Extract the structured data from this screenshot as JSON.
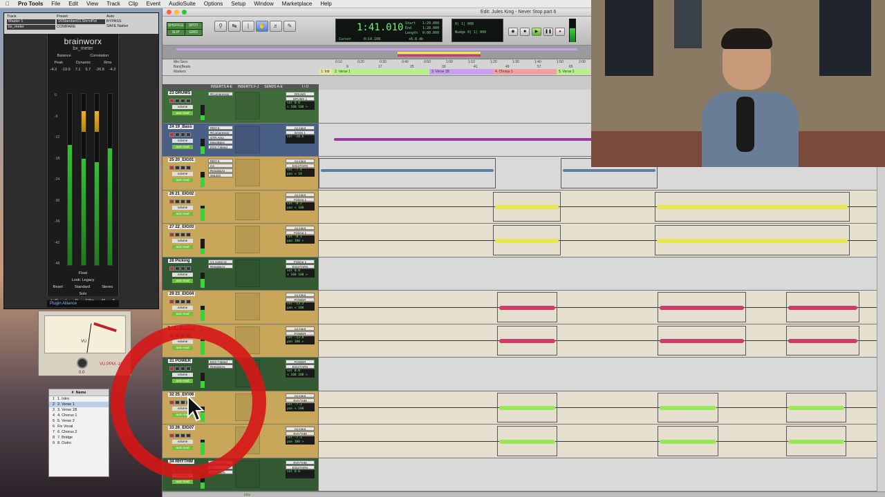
{
  "menubar": {
    "app": "Pro Tools",
    "items": [
      "File",
      "Edit",
      "View",
      "Track",
      "Clip",
      "Event",
      "AudioSuite",
      "Options",
      "Setup",
      "Window",
      "Marketplace",
      "Help"
    ]
  },
  "plugin": {
    "head": {
      "track_label": "Track",
      "track_value": "Master 1",
      "preset_label": "Preset",
      "preset_value": "16Standard1LShrmPot",
      "auto_label": "Auto",
      "bypass": "BYPASS",
      "compare": "COMPARE",
      "safe": "SAFE",
      "native": "Native",
      "insert": "bx_meter"
    },
    "brand": "brainworx",
    "subtitle": "bx_meter",
    "balance": "Balance",
    "correlation": "Correlation",
    "dynamic": "Dynamic",
    "peak": "Peak",
    "rms": "Rms",
    "values_row": [
      "-4.3",
      "-19.9",
      "7.1",
      "5.7",
      "-20.8",
      "-4.2"
    ],
    "scale": [
      "0",
      "-3",
      "-6",
      "-9",
      "-12",
      "-15",
      "-18",
      "-21",
      "-24",
      "-27",
      "-30",
      "-33",
      "-36",
      "-39",
      "-42",
      "-45",
      "-48"
    ],
    "float": "Float",
    "look": "Look: Legacy",
    "reset": "Reset",
    "standard": "Standard",
    "stereo": "Stereo",
    "solo": "Solo",
    "solo_buttons": [
      "L+R",
      "L",
      "R",
      "Filter",
      "M",
      "S"
    ],
    "footer": "Plugin Alliance"
  },
  "vu": {
    "label": "VU",
    "ppm": "VU PPM -18",
    "value": "0.0"
  },
  "memory": {
    "header_num": "#",
    "header_name": "Name",
    "rows": [
      {
        "n": "1",
        "name": "1. Intro"
      },
      {
        "n": "2",
        "name": "2. Verse 1"
      },
      {
        "n": "3",
        "name": "3. Verse 1B"
      },
      {
        "n": "4",
        "name": "4. Chorus 1"
      },
      {
        "n": "5",
        "name": "5. Verse 2"
      },
      {
        "n": "6",
        "name": "Fix Vocal"
      },
      {
        "n": "7",
        "name": "6. Chorus 2"
      },
      {
        "n": "8",
        "name": "7. Bridge"
      },
      {
        "n": "9",
        "name": "8. Outro"
      }
    ]
  },
  "edit": {
    "title": "Edit: Jules King - Never Stop part 6",
    "modes": [
      "SHUFFLE",
      "SPOT",
      "SLIP",
      "GRID"
    ],
    "counter_main": "1:41.010",
    "counter_labels": [
      "Start",
      "End",
      "Length"
    ],
    "counter_values": [
      "1:20.000",
      "1:20.000",
      "0:00.000"
    ],
    "cursor_label": "Cursor",
    "cursor_value": "0:14.108",
    "db_value": "+6.8 db",
    "nudge_label": "Nudge",
    "nudge_value": "0| 1| 000",
    "grid_value": "0| 1| 000",
    "ruler_labels": [
      "Min:Secs",
      "Bars|Beats",
      "Markers"
    ],
    "time_ticks": [
      "0:10",
      "0:20",
      "0:30",
      "0:40",
      "0:50",
      "1:00",
      "1:10",
      "1:20",
      "1:30",
      "1:40",
      "1:50",
      "2:00"
    ],
    "bar_ticks": [
      "9",
      "17",
      "25",
      "33",
      "41",
      "49",
      "57",
      "65"
    ],
    "markers": [
      {
        "label": "1. Intr",
        "color": "#e6e6a0"
      },
      {
        "label": "2. Verse 1",
        "color": "#b8f08a"
      },
      {
        "label": "3. Verse 1B",
        "color": "#c9a0f0"
      },
      {
        "label": "4. Chorus 1",
        "color": "#f0a0a0"
      },
      {
        "label": "5. Verse 2",
        "color": "#b8f08a"
      }
    ],
    "columns": [
      "INSERTS A-E",
      "INSERTS F-J",
      "SENDS A-E",
      "I / O"
    ],
    "status": "play"
  },
  "tracks": [
    {
      "name": "23 DRUMS",
      "color": "green",
      "inserts": [
        "RCompressor"
      ],
      "io": [
        "DRUMS",
        "DRUMS 1"
      ],
      "vol": "vol 0.0",
      "pan": "< 100 100 >",
      "lane": "grey"
    },
    {
      "name": "24 19_Bass",
      "color": "blue",
      "inserts": [
        "REQ 6",
        "RCompressor",
        "GTR Amp",
        "MaxxBass",
        "EQ3 7-Band"
      ],
      "io": [
        "no input",
        "BASS 1"
      ],
      "vol": "vol -10.6",
      "pan": "",
      "lane": "grey"
    },
    {
      "name": "25 20_EIG01",
      "color": "gold",
      "inserts": [
        "REQ 6",
        "C4",
        "RenaissAx",
        "SSLEQ"
      ],
      "io": [
        "no input",
        "EGUITARS"
      ],
      "vol": "vol -7.4",
      "pan": "pan < 10",
      "lane": "grey"
    },
    {
      "name": "26 21_EIG02",
      "color": "gold",
      "inserts": [],
      "io": [
        "no input",
        "Picking 1"
      ],
      "vol": "vol -8.2",
      "pan": "pan < 100",
      "lane": "tan"
    },
    {
      "name": "27 22_EIG03",
      "color": "gold",
      "inserts": [],
      "io": [
        "no input",
        "Picking 1"
      ],
      "vol": "vol -8.3",
      "pan": "pan 100 >",
      "lane": "tan"
    },
    {
      "name": "28 Picking",
      "color": "darkgreen",
      "inserts": [
        "C1 comp-sc",
        "RenaissAx"
      ],
      "io": [
        "Picking 1",
        "EGUITARS"
      ],
      "vol": "vol 0.0",
      "pan": "< 100 100 >",
      "lane": "grey"
    },
    {
      "name": "29 23_EIG04",
      "color": "gold",
      "inserts": [],
      "io": [
        "no input",
        "POWER"
      ],
      "vol": "vol -13.3",
      "pan": "pan < 100",
      "lane": "tan"
    },
    {
      "name": "30 24_EIG05",
      "color": "gold",
      "inserts": [],
      "io": [
        "no input",
        "POWER"
      ],
      "vol": "vol -13.0",
      "pan": "pan 100 >",
      "lane": "tan",
      "red": true
    },
    {
      "name": "31 POWER",
      "color": "darkgreen",
      "inserts": [
        "EQ3 7-Band",
        "RenaissAx"
      ],
      "io": [
        "POWER",
        "EGUITARS"
      ],
      "vol": "vol 0.0",
      "pan": "< 100 100 >",
      "lane": "grey"
    },
    {
      "name": "32 25_EIG06",
      "color": "gold",
      "inserts": [],
      "io": [
        "no input",
        "RHYTHM"
      ],
      "vol": "vol -7.3",
      "pan": "pan < 100",
      "lane": "tan"
    },
    {
      "name": "33 26_EIG07",
      "color": "gold",
      "inserts": [],
      "io": [
        "no input",
        "RHYTHM"
      ],
      "vol": "vol -7.3",
      "pan": "pan 100 >",
      "lane": "tan"
    },
    {
      "name": "34 RHYTHM",
      "color": "darkgreen",
      "inserts": [
        "EQ3 7-Band",
        "C4",
        "RenaissAx"
      ],
      "io": [
        "RHYTHM",
        "EGUITARS"
      ],
      "vol": "vol 0.0",
      "pan": "",
      "lane": "grey"
    }
  ],
  "track_buttons": {
    "volume": "volume",
    "auto": "auto read",
    "dyn": "dyn",
    "read": "read"
  },
  "colors": {
    "gold": "#c8a65a",
    "green": "#3f6b3a",
    "blue": "#4a5f86",
    "darkgreen": "#345a34",
    "clip_yellow": "#e8e84a",
    "clip_pink": "#d03a6a",
    "clip_green": "#9ae85a",
    "annotation": "#d61616"
  }
}
